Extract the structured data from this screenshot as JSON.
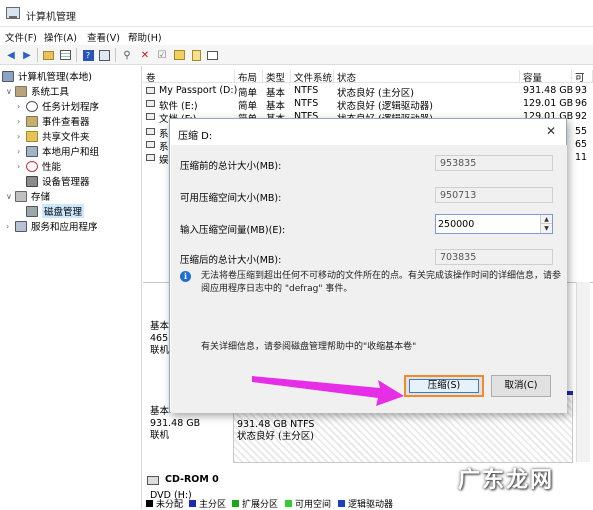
{
  "window": {
    "title": "计算机管理"
  },
  "menu": [
    "文件(F)",
    "操作(A)",
    "查看(V)",
    "帮助(H)"
  ],
  "toolbar": {
    "icons": [
      "back-arrow-icon",
      "forward-arrow-icon",
      "folder-icon",
      "grid-icon",
      "help-icon",
      "properties-icon",
      "connect-icon",
      "delete-icon",
      "check-icon",
      "folder-open-icon",
      "document-icon",
      "window-icon"
    ]
  },
  "tree": {
    "root": "计算机管理(本地)",
    "system_tools": "系统工具",
    "task_scheduler": "任务计划程序",
    "event_viewer": "事件查看器",
    "shared_folders": "共享文件夹",
    "local_users": "本地用户和组",
    "performance": "性能",
    "device_manager": "设备管理器",
    "storage": "存储",
    "disk_management": "磁盘管理",
    "services": "服务和应用程序"
  },
  "volumes": {
    "columns": [
      "卷",
      "布局",
      "类型",
      "文件系统",
      "状态",
      "容量",
      "可"
    ],
    "rows": [
      {
        "name": "My Passport (D:)",
        "layout": "简单",
        "type": "基本",
        "fs": "NTFS",
        "status": "状态良好 (主分区)",
        "capacity": "931.48 GB",
        "free": "93"
      },
      {
        "name": "软件 (E:)",
        "layout": "简单",
        "type": "基本",
        "fs": "NTFS",
        "status": "状态良好 (逻辑驱动器)",
        "capacity": "129.01 GB",
        "free": "96"
      },
      {
        "name": "文档 (F:)",
        "layout": "简单",
        "type": "基本",
        "fs": "NTFS",
        "status": "状态良好 (逻辑驱动器)",
        "capacity": "129.01 GB",
        "free": "92"
      },
      {
        "name": "系",
        "free": "55"
      },
      {
        "name": "系",
        "free": "65"
      },
      {
        "name": "娱",
        "free": "11"
      }
    ]
  },
  "graph": {
    "disk_partial": {
      "line1": "基本",
      "line2": "465.",
      "line3": "联机"
    },
    "disk1": {
      "line1": "基本",
      "line2": "931.48 GB",
      "line3": "联机"
    },
    "disk1_volume": {
      "line1": "931.48 GB NTFS",
      "line2": "状态良好 (主分区)"
    },
    "cdrom": {
      "title": "CD-ROM 0",
      "line2": "DVD (H:)"
    }
  },
  "legend": [
    {
      "label": "未分配",
      "color": "#000000"
    },
    {
      "label": "主分区",
      "color": "#1d2bb3"
    },
    {
      "label": "扩展分区",
      "color": "#1aa81a"
    },
    {
      "label": "可用空间",
      "color": "#33cc33"
    },
    {
      "label": "逻辑驱动器",
      "color": "#1d3fc7"
    }
  ],
  "dialog": {
    "title": "压缩 D:",
    "total_before_label": "压缩前的总计大小(MB):",
    "total_before_value": "953835",
    "available_label": "可用压缩空间大小(MB):",
    "available_value": "950713",
    "amount_label": "输入压缩空间量(MB)(E):",
    "amount_value": "250000",
    "total_after_label": "压缩后的总计大小(MB):",
    "total_after_value": "703835",
    "info": "无法将卷压缩到超出任何不可移动的文件所在的点。有关完成该操作时间的详细信息，请参阅应用程序日志中的 \"defrag\" 事件。",
    "help": "有关详细信息，请参阅磁盘管理帮助中的\"收缩基本卷\"",
    "ok_label": "压缩(S)",
    "cancel_label": "取消(C)"
  },
  "annotation": {
    "arrow_color": "#e62ee6",
    "highlight_color": "#f08c2e"
  },
  "watermark": "广东龙网"
}
